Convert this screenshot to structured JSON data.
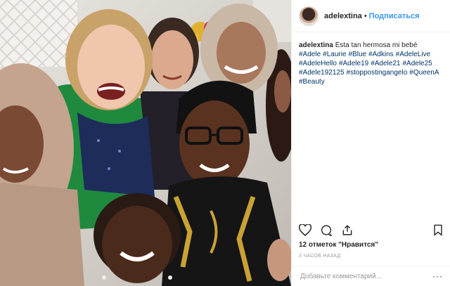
{
  "post": {
    "username": "adelextina",
    "separator": "•",
    "follow_label": "Подписаться",
    "caption_user": "adelextina",
    "caption_text": "Esta tan hermosa mi bebé",
    "hashtags": [
      "#Adele",
      "#Laurie",
      "#Blue",
      "#Adkins",
      "#AdeleLive",
      "#AdeleHello",
      "#Adele19",
      "#Adele21",
      "#Adele25",
      "#Adele192125",
      "#stoppostingangelo",
      "#QueenA",
      "#Beauty"
    ],
    "likes": "12 отметок \"Нравится\"",
    "time": "3 ЧАСОВ НАЗАД",
    "comment_placeholder": "Добавьте комментарий...",
    "more_label": "···"
  },
  "icons": {
    "like": "heart-icon",
    "comment": "comment-icon",
    "share": "share-icon",
    "save": "bookmark-icon"
  },
  "colors": {
    "link": "#003569",
    "follow": "#3897f0",
    "text": "#262626",
    "muted": "#999999"
  }
}
